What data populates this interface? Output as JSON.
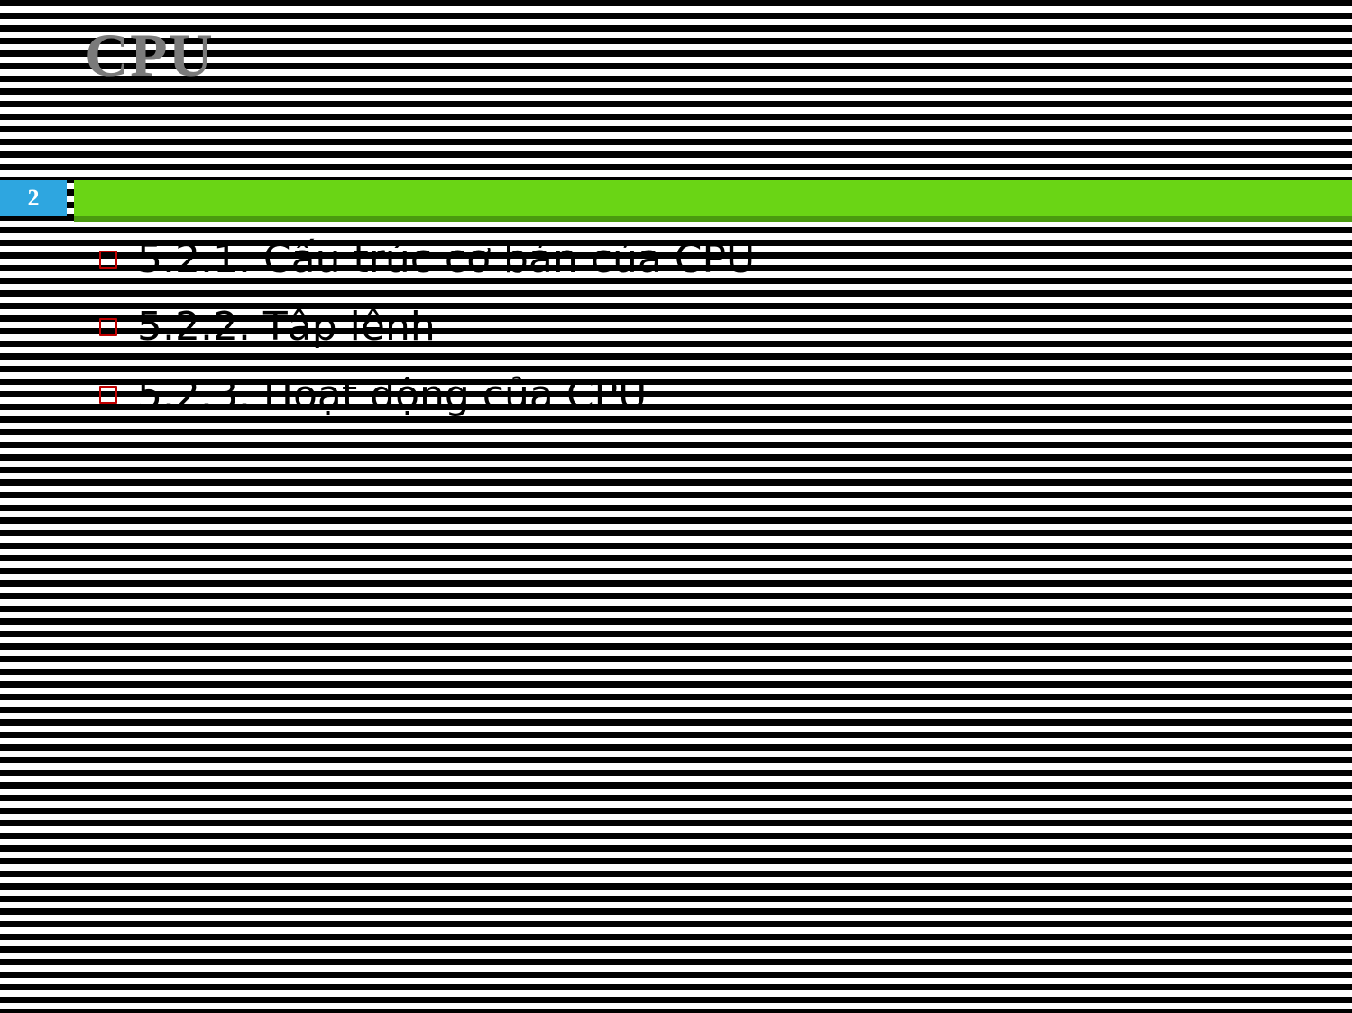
{
  "slide": {
    "title": "CPU",
    "page_number": "2",
    "bullets": [
      {
        "text": "5.2.1. Cấu trúc cơ bản của CPU"
      },
      {
        "text": "5.2.2. Tập lệnh"
      },
      {
        "text": "5.2.3. Hoạt động của CPU"
      }
    ]
  }
}
